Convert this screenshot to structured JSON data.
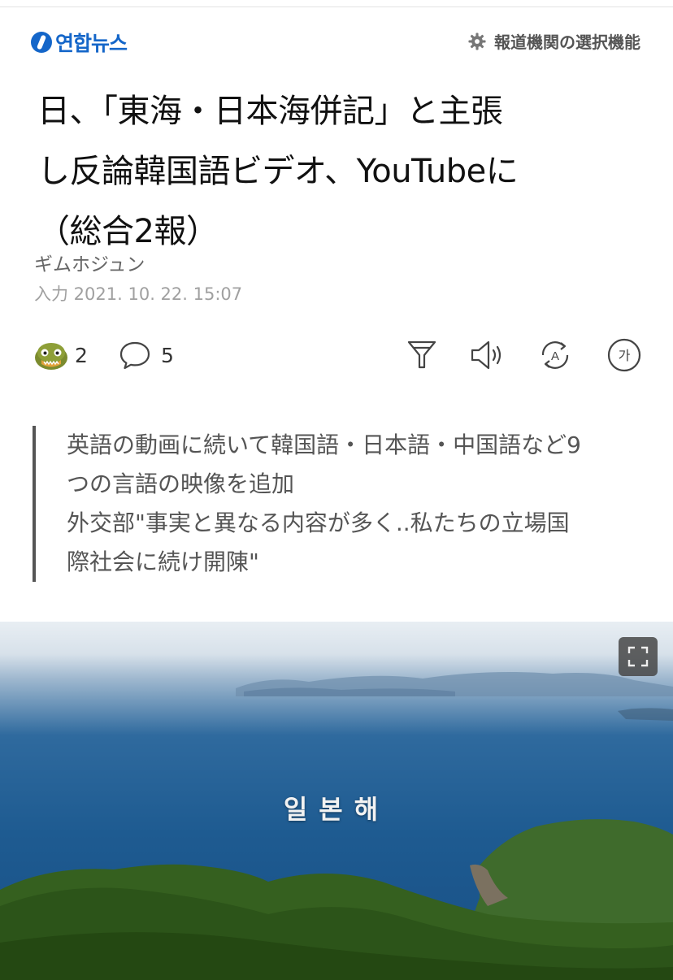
{
  "header": {
    "logo_text": "연합뉴스",
    "publisher_select_label": "報道機関の選択機能"
  },
  "article": {
    "title_lines": [
      "日、「東海・日本海併記」と主張",
      "し反論韓国語ビデオ、YouTubeに",
      "（総合2報）"
    ],
    "author": "ギムホジュン",
    "timestamp": "入力 2021. 10. 22. 15:07"
  },
  "actions": {
    "reaction_count": "2",
    "comment_count": "5",
    "icons": [
      "reaction-emoji-icon",
      "comment-icon",
      "filter-icon",
      "speaker-icon",
      "translate-icon",
      "font-size-icon"
    ],
    "font_size_glyph": "가",
    "translate_glyph": "A"
  },
  "summary": {
    "lines": [
      "英語の動画に続いて韓国語・日本語・中国語など9",
      "つの言語の映像を追加",
      "外交部\"事実と異なる内容が多く..私たちの立場国",
      "際社会に続け開陳\""
    ]
  },
  "video": {
    "caption": "일본해",
    "expand_icon": "fullscreen-icon"
  },
  "colors": {
    "brand": "#1466c9",
    "sea": "#1e5b91",
    "forest": "#3f6b2c"
  }
}
